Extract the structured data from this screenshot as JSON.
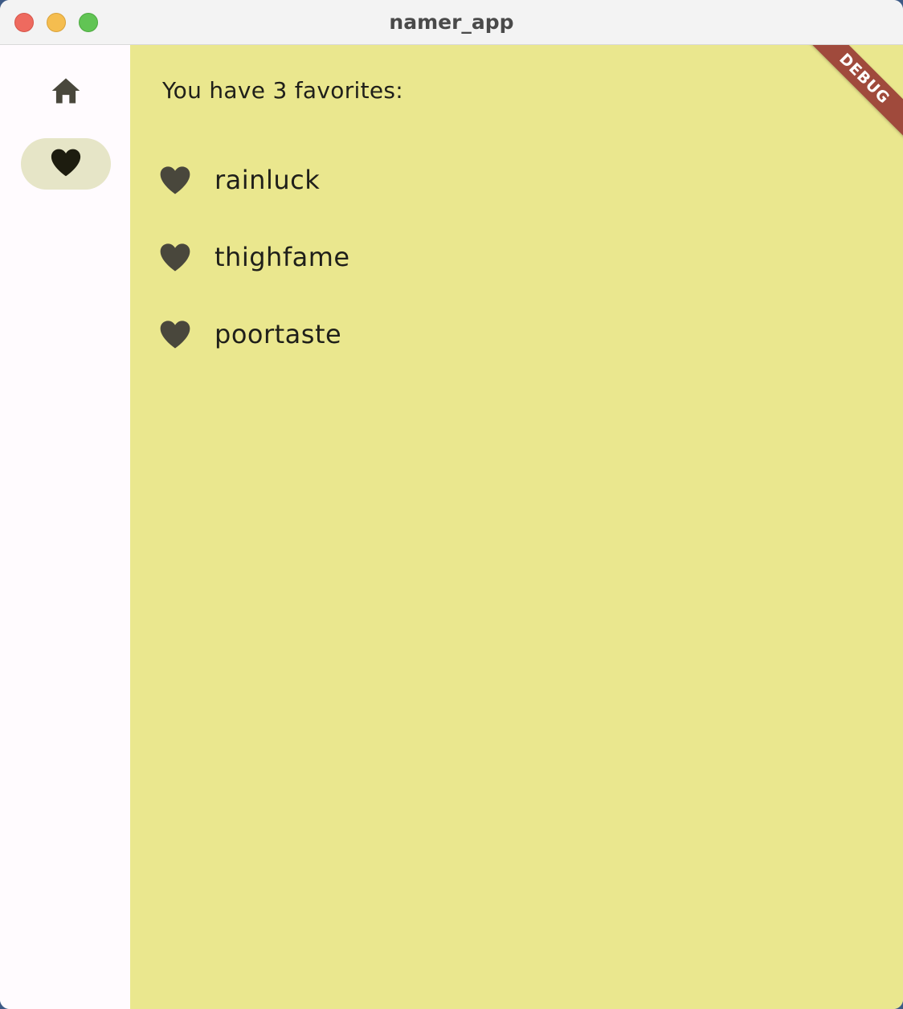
{
  "window": {
    "title": "namer_app"
  },
  "rail": {
    "items": [
      {
        "icon": "home-icon",
        "selected": false
      },
      {
        "icon": "heart-icon",
        "selected": true
      }
    ]
  },
  "favorites": {
    "count_text": "You have 3 favorites:",
    "items": [
      {
        "label": "rainluck",
        "icon": "heart-icon"
      },
      {
        "label": "thighfame",
        "icon": "heart-icon"
      },
      {
        "label": "poortaste",
        "icon": "heart-icon"
      }
    ]
  },
  "debug_banner": {
    "label": "DEBUG"
  },
  "colors": {
    "content_background": "#eae78e",
    "rail_background": "#fffbfe",
    "rail_selected_indicator": "#e6e5c7",
    "icon": "#49473c",
    "debug_banner": "#a04a3c"
  }
}
